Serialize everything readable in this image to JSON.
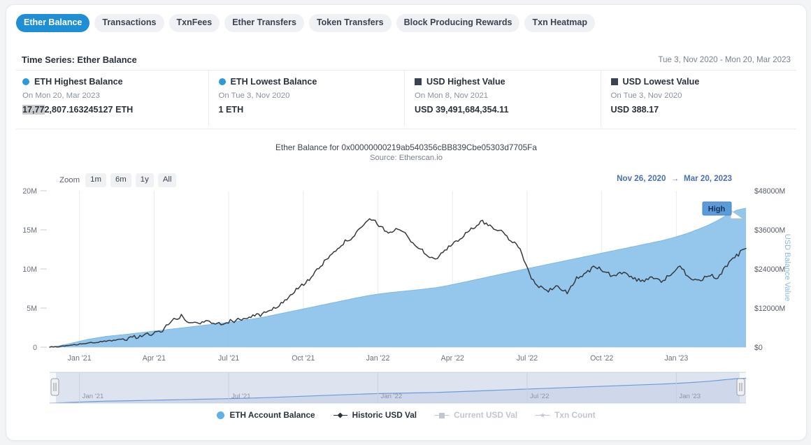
{
  "tabs": [
    {
      "label": "Ether Balance",
      "active": true
    },
    {
      "label": "Transactions",
      "active": false
    },
    {
      "label": "TxnFees",
      "active": false
    },
    {
      "label": "Ether Transfers",
      "active": false
    },
    {
      "label": "Token Transfers",
      "active": false
    },
    {
      "label": "Block Producing Rewards",
      "active": false
    },
    {
      "label": "Txn Heatmap",
      "active": false
    }
  ],
  "header": {
    "title": "Time Series: Ether Balance",
    "date_range": "Tue 3, Nov 2020 - Mon 20, Mar 2023"
  },
  "stats": [
    {
      "marker": "blue-circle-icon",
      "marker_color": "#2c9ad8",
      "label": "ETH Highest Balance",
      "date": "On Mon 20, Mar 2023",
      "value_selected": "17,77",
      "value_rest": "2,807.163245127 ETH"
    },
    {
      "marker": "blue-circle-icon",
      "marker_color": "#2c9ad8",
      "label": "ETH Lowest Balance",
      "date": "On Tue 3, Nov 2020",
      "value_selected": "",
      "value_rest": "1 ETH"
    },
    {
      "marker": "dark-square-icon",
      "marker_color": "#3b4252",
      "label": "USD Highest Value",
      "date": "On Mon 8, Nov 2021",
      "value_selected": "",
      "value_rest": "USD 39,491,684,354.11"
    },
    {
      "marker": "dark-square-icon",
      "marker_color": "#3b4252",
      "label": "USD Lowest Value",
      "date": "On Tue 3, Nov 2020",
      "value_selected": "",
      "value_rest": "USD 388.17"
    }
  ],
  "rangeselector": {
    "zoom_label": "Zoom",
    "buttons": [
      "1m",
      "6m",
      "1y",
      "All"
    ],
    "from": "Nov 26, 2020",
    "arrow": "→",
    "to": "Mar 20, 2023"
  },
  "annotation": {
    "flag_label": "High"
  },
  "legend": [
    {
      "label": "ETH Account Balance",
      "glyph": "circle",
      "color": "#62b0e8",
      "enabled": true
    },
    {
      "label": "Historic USD Val",
      "glyph": "line-marker",
      "color": "#2b313b",
      "enabled": true
    },
    {
      "label": "Current USD Val",
      "glyph": "line-square",
      "color": "#c2c6cd",
      "enabled": false
    },
    {
      "label": "Txn Count",
      "glyph": "line-star",
      "color": "#c2c6cd",
      "enabled": false
    }
  ],
  "chart_data": {
    "type": "area",
    "title": "Ether Balance for 0x00000000219ab540356cBB839Cbe05303d7705Fa",
    "subtitle": "Source: Etherscan.io",
    "xlabel": "",
    "ylabel": "",
    "ylabel_right": "USD Balance Value",
    "grid": true,
    "legend_position": "bottom",
    "x_ticks": [
      "Jan '21",
      "Apr '21",
      "Jul '21",
      "Oct '21",
      "Jan '22",
      "Apr '22",
      "Jul '22",
      "Oct '22",
      "Jan '23"
    ],
    "y_ticks_left": [
      "0",
      "5M",
      "10M",
      "15M",
      "20M"
    ],
    "y_ticks_right": [
      "$0",
      "$12000M",
      "$24000M",
      "$36000M",
      "$48000M"
    ],
    "ylim_left": [
      0,
      20000000
    ],
    "ylim_right": [
      0,
      48000000000
    ],
    "xlim": [
      "Nov 26, 2020",
      "Mar 20, 2023"
    ],
    "navigator_ticks": [
      "Jan '21",
      "Jul '21",
      "Jan '22",
      "Jul '22",
      "Jan '23"
    ],
    "series": [
      {
        "name": "ETH Account Balance",
        "type": "area",
        "color": "#8cc2ec",
        "axis": "left",
        "units": "ETH",
        "values": [
          5000,
          180000,
          420000,
          700000,
          980000,
          1180000,
          1380000,
          1500000,
          1620000,
          1760000,
          1900000,
          2040000,
          2180000,
          2320000,
          2460000,
          2600000,
          2740000,
          2880000,
          3020000,
          3170000,
          3330000,
          3500000,
          3680000,
          3900000,
          4150000,
          4400000,
          4650000,
          4900000,
          5150000,
          5400000,
          5650000,
          5900000,
          6150000,
          6400000,
          6620000,
          6800000,
          6950000,
          7080000,
          7200000,
          7320000,
          7450000,
          7600000,
          7800000,
          8050000,
          8300000,
          8560000,
          8820000,
          9080000,
          9340000,
          9600000,
          9860000,
          10100000,
          10350000,
          10600000,
          10850000,
          11100000,
          11350000,
          11600000,
          11850000,
          12100000,
          12350000,
          12600000,
          12850000,
          13100000,
          13350000,
          13600000,
          13900000,
          14250000,
          14650000,
          15100000,
          15600000,
          16200000,
          16900000,
          17500000,
          17772807
        ]
      },
      {
        "name": "Historic USD Val",
        "type": "line",
        "color": "#34393f",
        "axis": "right",
        "units": "USD",
        "values": [
          388,
          150000000,
          420000000,
          900000000,
          1250000000,
          1500000000,
          1850000000,
          2100000000,
          2600000000,
          3100000000,
          3600000000,
          4200000000,
          5200000000,
          8200000000,
          9500000000,
          7200000000,
          7500000000,
          8000000000,
          7400000000,
          7800000000,
          8400000000,
          9100000000,
          9700000000,
          10500000000,
          12000000000,
          14500000000,
          17000000000,
          19500000000,
          22000000000,
          25500000000,
          29000000000,
          31500000000,
          33500000000,
          36000000000,
          39491684354,
          37500000000,
          35000000000,
          36500000000,
          34000000000,
          31000000000,
          28500000000,
          27000000000,
          29500000000,
          32000000000,
          34500000000,
          36500000000,
          38500000000,
          37000000000,
          35500000000,
          33000000000,
          30500000000,
          22000000000,
          18500000000,
          17500000000,
          18500000000,
          17000000000,
          21000000000,
          22500000000,
          25000000000,
          23000000000,
          21500000000,
          23500000000,
          21000000000,
          20500000000,
          21500000000,
          20000000000,
          22500000000,
          24500000000,
          21500000000,
          20500000000,
          22000000000,
          21500000000,
          25000000000,
          28000000000,
          30500000000
        ]
      }
    ]
  }
}
